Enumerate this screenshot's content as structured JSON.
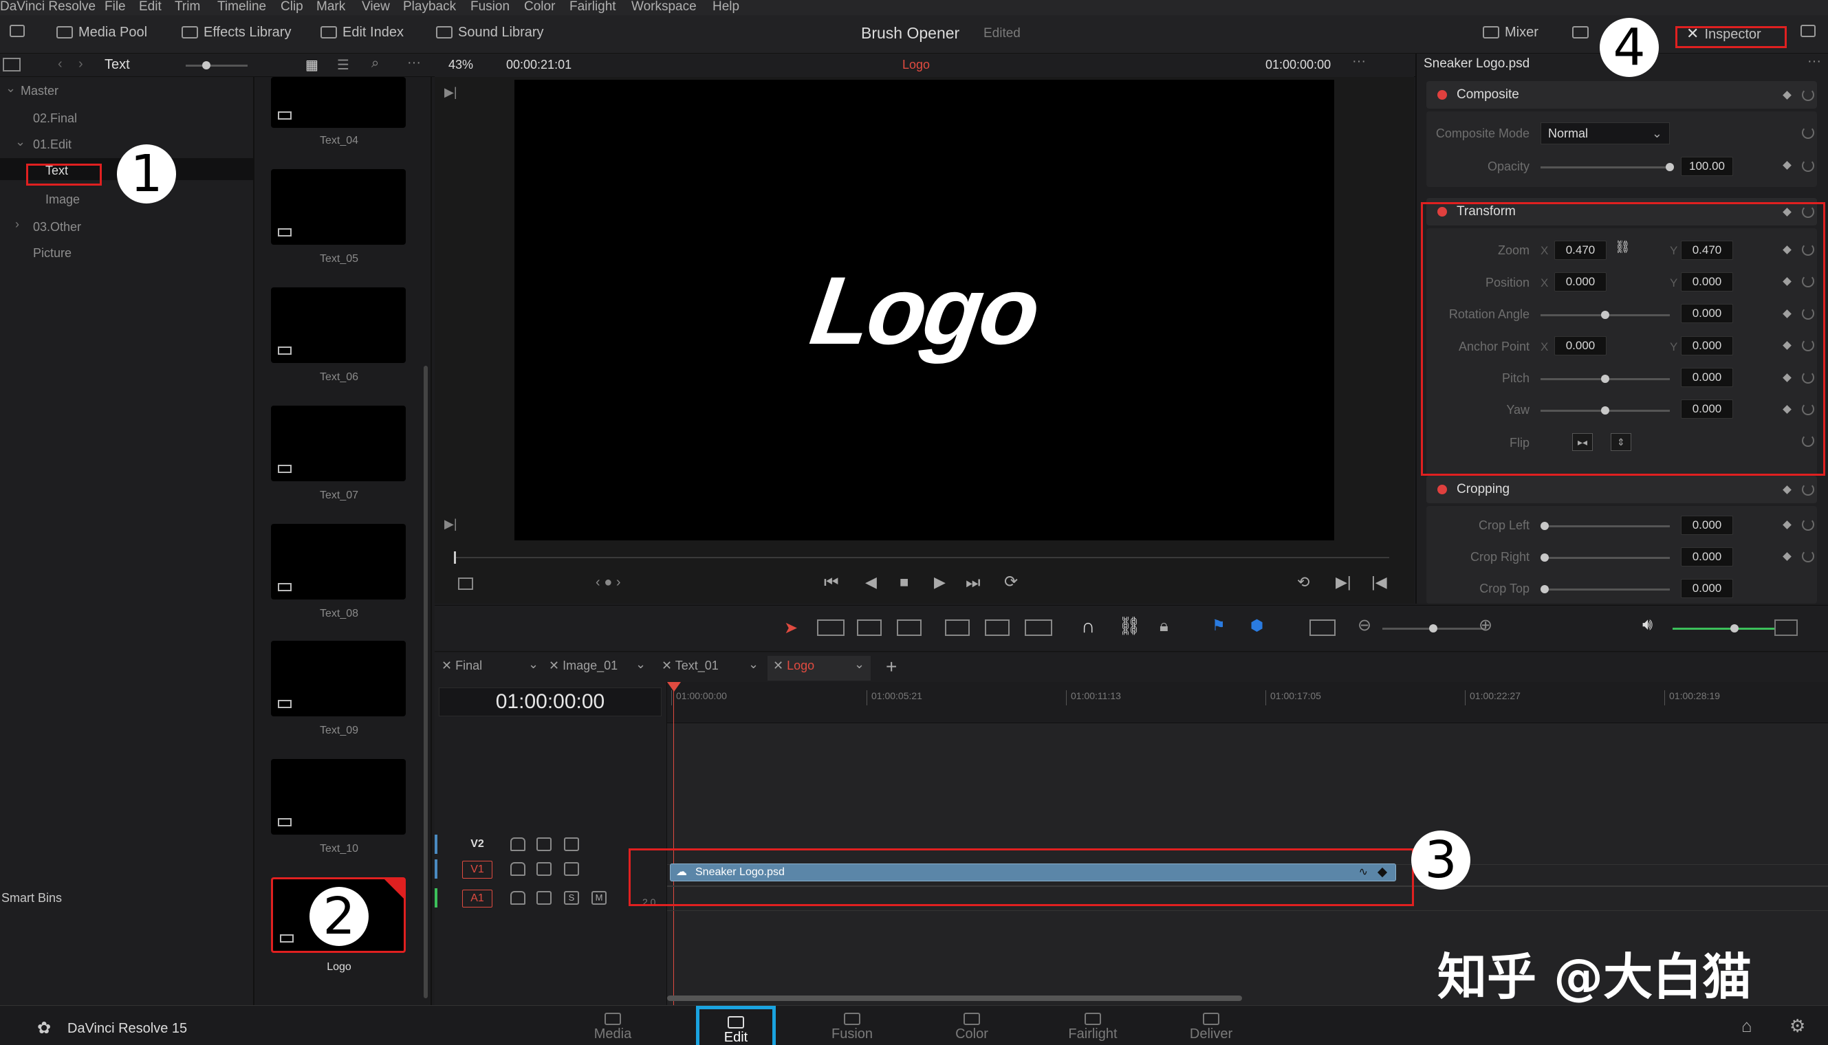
{
  "menubar": {
    "items": [
      "DaVinci Resolve",
      "File",
      "Edit",
      "Trim",
      "Timeline",
      "Clip",
      "Mark",
      "View",
      "Playback",
      "Fusion",
      "Color",
      "Fairlight",
      "Workspace",
      "Help"
    ]
  },
  "toolbar": {
    "media_pool": "Media Pool",
    "effects_library": "Effects Library",
    "edit_index": "Edit Index",
    "sound_library": "Sound Library",
    "project_title": "Brush Opener",
    "project_status": "Edited",
    "mixer": "Mixer",
    "inspector": "Inspector"
  },
  "subbar": {
    "bin_name": "Text",
    "zoom": "43%",
    "source_timecode": "00:00:21:01",
    "timeline_name": "Logo",
    "viewer_timecode": "01:00:00:00",
    "inspector_title": "Sneaker Logo.psd"
  },
  "bins": {
    "items": [
      {
        "label": "Master"
      },
      {
        "label": "02.Final"
      },
      {
        "label": "01.Edit"
      },
      {
        "label": "Text"
      },
      {
        "label": "Image"
      },
      {
        "label": "03.Other"
      },
      {
        "label": "Picture"
      }
    ],
    "smart_bins": "Smart Bins"
  },
  "thumbnails": [
    "Text_04",
    "Text_05",
    "Text_06",
    "Text_07",
    "Text_08",
    "Text_09",
    "Text_10",
    "Logo"
  ],
  "viewer": {
    "logo_text": "Logo"
  },
  "inspector": {
    "composite": {
      "title": "Composite",
      "mode_label": "Composite Mode",
      "mode_value": "Normal",
      "opacity_label": "Opacity",
      "opacity_value": "100.00",
      "opacity_fraction": 1.0
    },
    "transform": {
      "title": "Transform",
      "zoom_label": "Zoom",
      "zoom_x": "0.470",
      "zoom_y": "0.470",
      "position_label": "Position",
      "position_x": "0.000",
      "position_y": "0.000",
      "rotation_label": "Rotation Angle",
      "rotation_value": "0.000",
      "anchor_label": "Anchor Point",
      "anchor_x": "0.000",
      "anchor_y": "0.000",
      "pitch_label": "Pitch",
      "pitch_value": "0.000",
      "yaw_label": "Yaw",
      "yaw_value": "0.000",
      "flip_label": "Flip"
    },
    "cropping": {
      "title": "Cropping",
      "crop_left_label": "Crop Left",
      "crop_left_value": "0.000",
      "crop_right_label": "Crop Right",
      "crop_right_value": "0.000",
      "crop_top_label": "Crop Top",
      "crop_top_value": "0.000"
    }
  },
  "timeline": {
    "tabs": [
      "Final",
      "Image_01",
      "Text_01",
      "Logo"
    ],
    "active_tab": "Logo",
    "timecode": "01:00:00:00",
    "ruler": [
      "01:00:00:00",
      "01:00:05:21",
      "01:00:11:13",
      "01:00:17:05",
      "01:00:22:27",
      "01:00:28:19"
    ],
    "tracks": [
      "V2",
      "V1",
      "A1"
    ],
    "audio_level": "2.0",
    "solo": "S",
    "mute": "M",
    "clip_name": "Sneaker Logo.psd"
  },
  "pagebar": {
    "app_name": "DaVinci Resolve 15",
    "pages": [
      "Media",
      "Edit",
      "Fusion",
      "Color",
      "Fairlight",
      "Deliver"
    ],
    "active_page": "Edit"
  },
  "annotations": [
    "1",
    "2",
    "3",
    "4"
  ],
  "watermark": "知乎 @大白猫",
  "colors": {
    "accent_red": "#e02020",
    "active_blue": "#1aa3e0",
    "clip_blue": "#5b86a8",
    "timeline_red": "#e04b40"
  }
}
